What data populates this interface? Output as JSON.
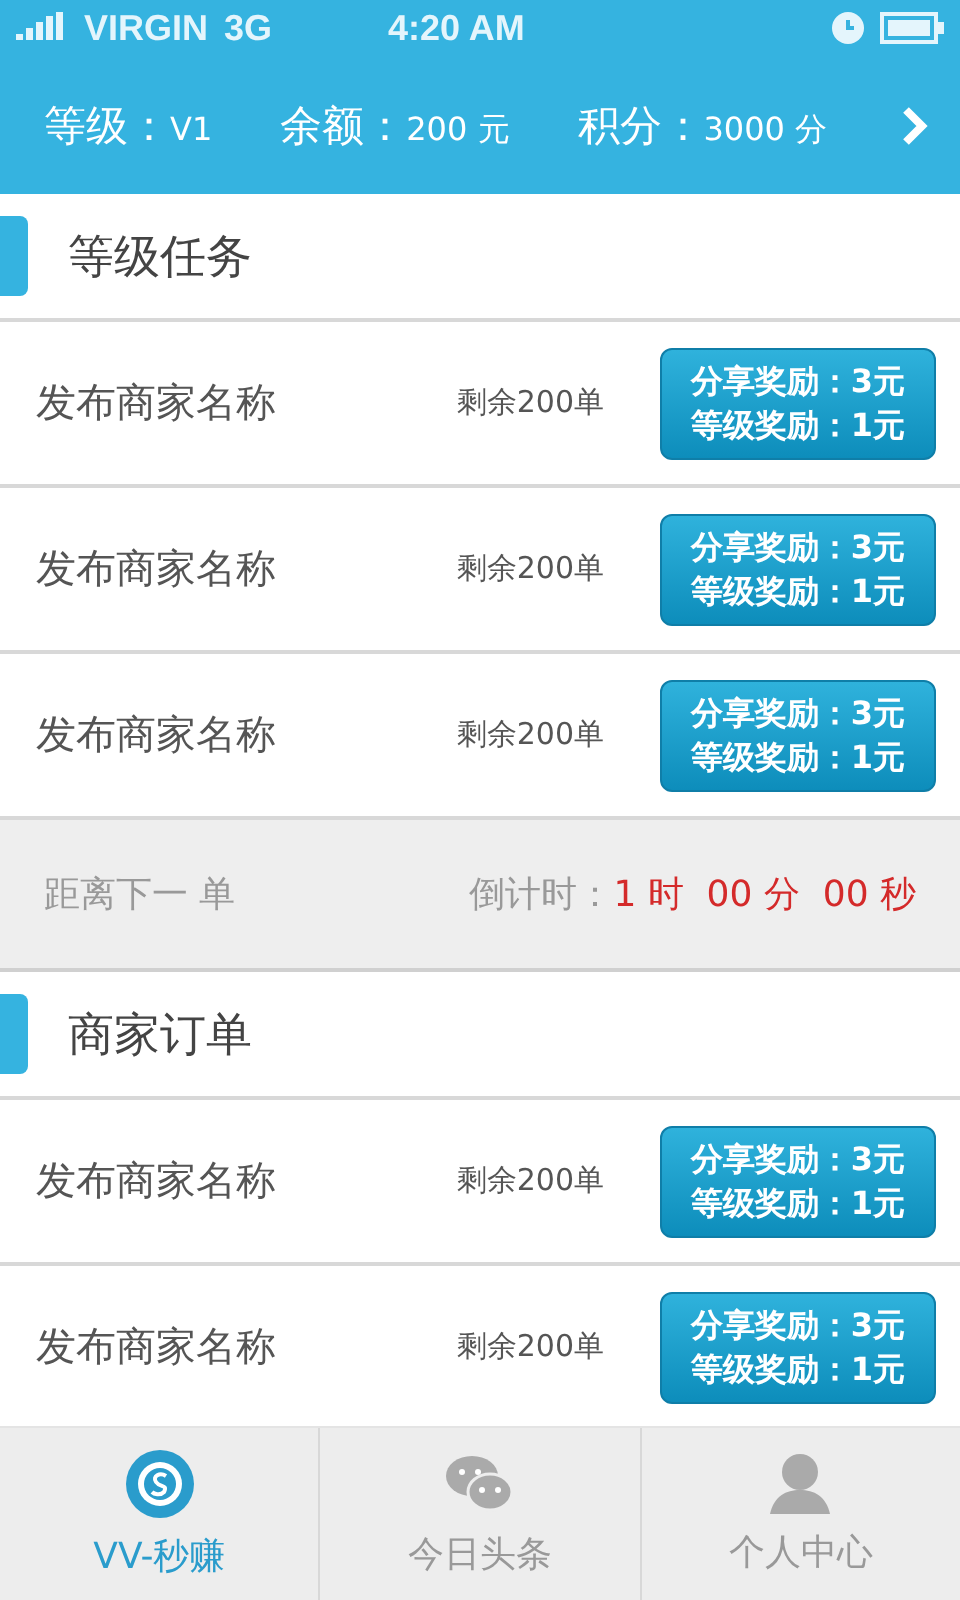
{
  "status_bar": {
    "carrier": "VIRGIN",
    "network": "3G",
    "time": "4:20 AM"
  },
  "header": {
    "stats": [
      {
        "label": "等级：",
        "value": "V1"
      },
      {
        "label": "余额：",
        "value": "200 元"
      },
      {
        "label": "积分：",
        "value": "3000 分"
      }
    ]
  },
  "sections": [
    {
      "title": "等级任务",
      "orders": [
        {
          "name": "发布商家名称",
          "remaining": "剩余200单",
          "reward_lines": [
            "分享奖励：3元",
            "等级奖励：1元"
          ]
        },
        {
          "name": "发布商家名称",
          "remaining": "剩余200单",
          "reward_lines": [
            "分享奖励：3元",
            "等级奖励：1元"
          ]
        },
        {
          "name": "发布商家名称",
          "remaining": "剩余200单",
          "reward_lines": [
            "分享奖励：3元",
            "等级奖励：1元"
          ]
        }
      ],
      "countdown": {
        "label": "距离下一 单",
        "prefix": "倒计时：",
        "value": "1 时  00 分  00 秒"
      }
    },
    {
      "title": "商家订单",
      "orders": [
        {
          "name": "发布商家名称",
          "remaining": "剩余200单",
          "reward_lines": [
            "分享奖励：3元",
            "等级奖励：1元"
          ]
        },
        {
          "name": "发布商家名称",
          "remaining": "剩余200单",
          "reward_lines": [
            "分享奖励：3元",
            "等级奖励：1元"
          ]
        }
      ]
    }
  ],
  "tabs": [
    {
      "label": "VV-秒赚",
      "kind": "chip",
      "selected": true
    },
    {
      "label": "今日头条",
      "kind": "chat",
      "selected": false
    },
    {
      "label": "个人中心",
      "kind": "person",
      "selected": false
    }
  ]
}
